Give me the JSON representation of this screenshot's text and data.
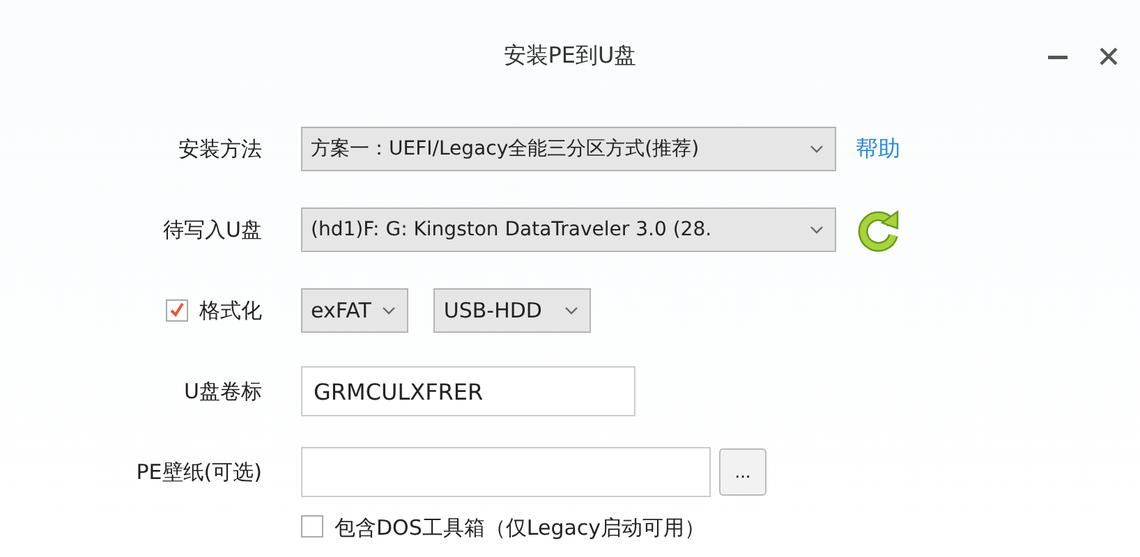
{
  "window": {
    "title": "安装PE到U盘"
  },
  "rows": [
    {
      "kind": "select",
      "label": "安装方法",
      "value": "方案一：UEFI/Legacy全能三分区方式(推荐)",
      "link": "帮助"
    },
    {
      "kind": "drive",
      "label": "待写入U盘",
      "value": "(hd1)F: G: Kingston DataTraveler 3.0 (28."
    },
    {
      "kind": "format",
      "label": "格式化",
      "checked": true,
      "selects": [
        "exFAT",
        "USB-HDD"
      ]
    },
    {
      "kind": "text",
      "label": "U盘卷标",
      "value": "GRMCULXFRER"
    },
    {
      "kind": "file",
      "label": "PE壁纸(可选)",
      "button": "..."
    },
    {
      "kind": "option",
      "label": "包含DOS工具箱（仅Legacy启动可用）",
      "checked": false
    }
  ]
}
